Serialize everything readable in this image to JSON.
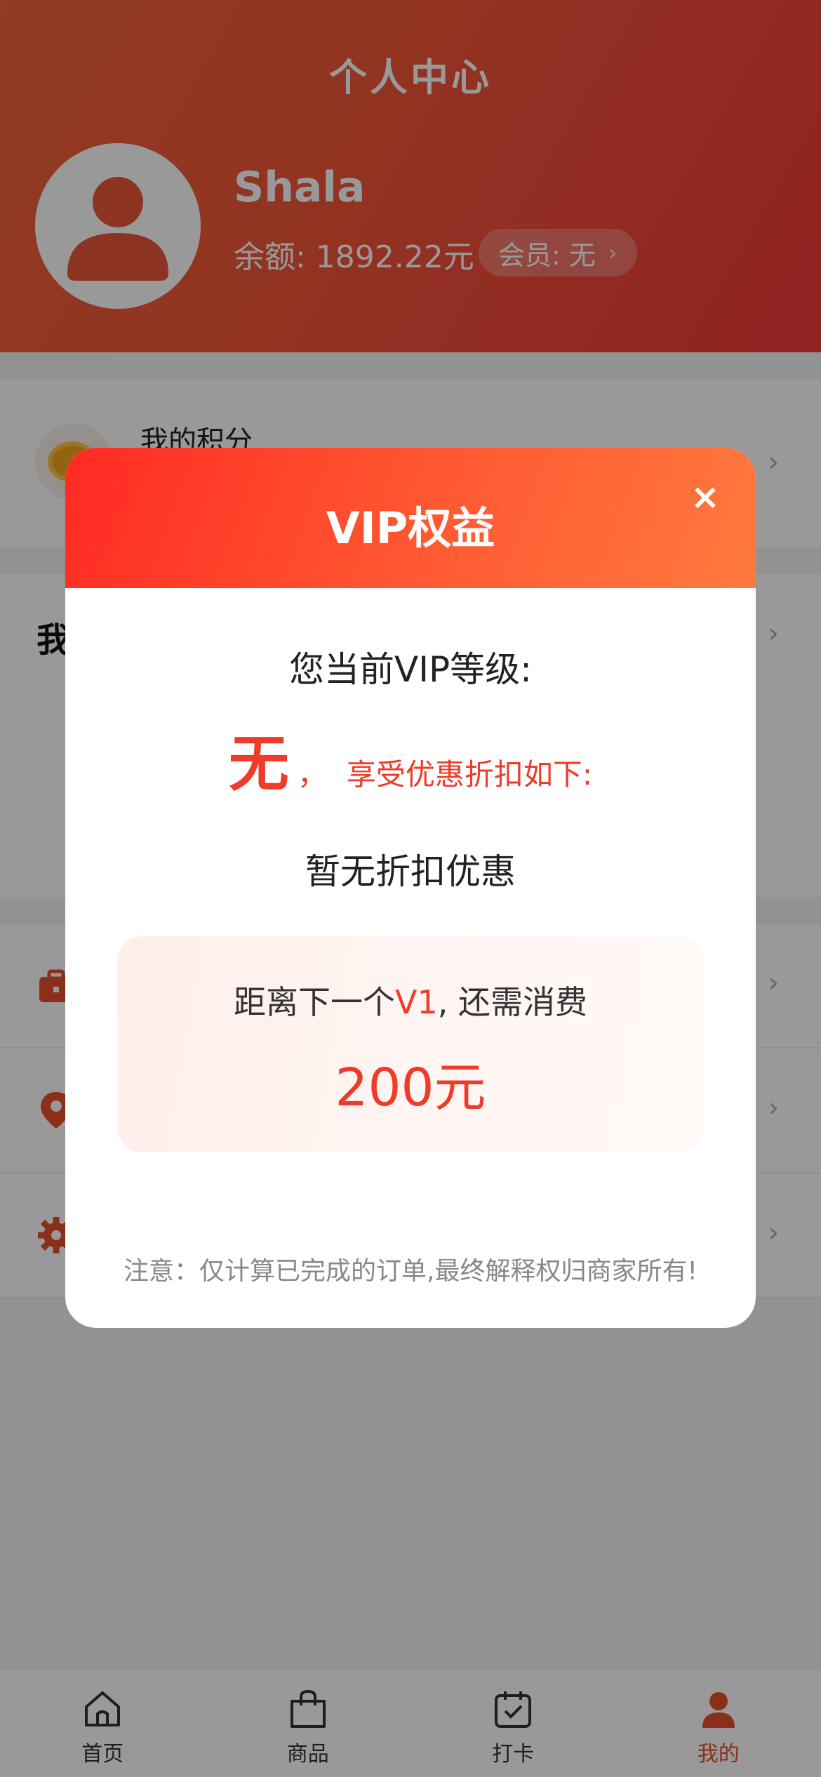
{
  "header": {
    "title": "个人中心",
    "username": "Shala",
    "balance": "余额: 1892.22元",
    "member": "会员: 无",
    "member_chevron": "›"
  },
  "points": {
    "title": "我的积分",
    "chevron": "›"
  },
  "orders": {
    "title": "我",
    "chevron": "›"
  },
  "menu": {
    "chevron": "›"
  },
  "modal": {
    "title": "VIP权益",
    "close": "×",
    "level_label": "您当前VIP等级:",
    "level_value": "无",
    "level_sep": "，",
    "level_desc": "享受优惠折扣如下:",
    "no_discount": "暂无折扣优惠",
    "next_prefix": "距离下一个",
    "next_level": "V1",
    "next_suffix": ", 还需消费",
    "next_amount": "200元",
    "note": "注意：仅计算已完成的订单,最终解释权归商家所有!"
  },
  "tabbar": {
    "items": [
      {
        "label": "首页",
        "icon": "home-icon"
      },
      {
        "label": "商品",
        "icon": "bag-icon"
      },
      {
        "label": "打卡",
        "icon": "calendar-check-icon"
      },
      {
        "label": "我的",
        "icon": "user-icon"
      }
    ],
    "active_index": 3
  },
  "colors": {
    "accent": "#ef3b2a",
    "header_gradient": [
      "#f0633a",
      "#f03a3a"
    ]
  }
}
